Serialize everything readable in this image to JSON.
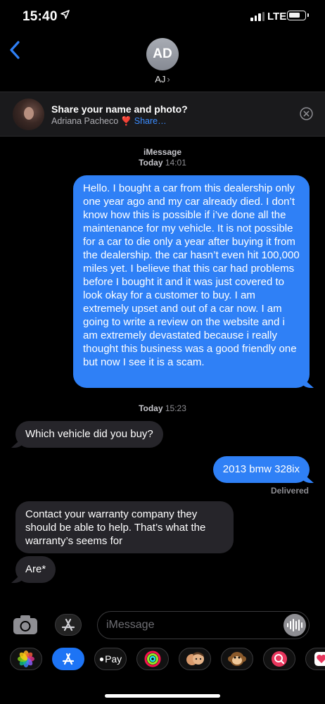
{
  "status_bar": {
    "time": "15:40",
    "network": "LTE"
  },
  "header": {
    "avatar_initials": "AD",
    "contact_name": "AJ"
  },
  "share_banner": {
    "title": "Share your name and photo?",
    "name": "Adriana Pacheco",
    "heart": "❣️",
    "action": "Share…"
  },
  "conversation": {
    "service_label": "iMessage",
    "timestamp1_day": "Today",
    "timestamp1_time": "14:01",
    "message1": "Hello. I bought a car from this dealership only one year ago and my car already died. I don’t know how this is possible if i’ve done all the maintenance for my vehicle. It is not possible for a car to die only a year after buying it from the dealership. the car hasn’t even hit 100,000 miles yet. I believe that this car had problems before I bought it and it was just covered to look okay for a customer to buy. I am extremely upset and out of a car now. I am going to write a review on the website and i am extremely devastated because i really thought this business was a good friendly one but now I see it is a scam.",
    "timestamp2_day": "Today",
    "timestamp2_time": "15:23",
    "message2": "Which vehicle did you buy?",
    "message3": "2013 bmw 328ix",
    "delivered": "Delivered",
    "message4": "Contact your warranty company they should be able to help. That’s what the warranty’s seems for",
    "message5": "Are*"
  },
  "input_bar": {
    "placeholder": "iMessage"
  },
  "app_drawer": {
    "apple_pay_label": "Pay"
  },
  "colors": {
    "sent_bubble": "#2f80f6",
    "received_bubble": "#26252a",
    "link_blue": "#3b8cff",
    "background": "#000000"
  }
}
